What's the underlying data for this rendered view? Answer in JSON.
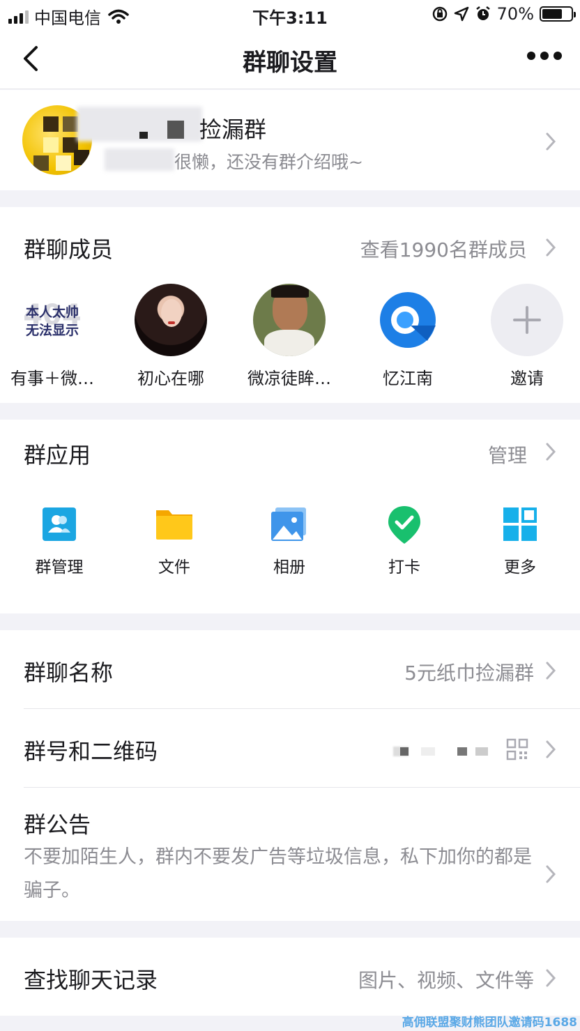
{
  "status_bar": {
    "carrier": "中国电信",
    "time": "下午3:11",
    "battery_percent": "70%",
    "battery_level": 0.7
  },
  "nav": {
    "title": "群聊设置"
  },
  "group": {
    "name": "捡漏群",
    "intro": "很懒，还没有群介绍哦~"
  },
  "members": {
    "title": "群聊成员",
    "view_all": "查看1990名群成员",
    "list": [
      {
        "name": "有事＋微…",
        "avatar_text": "本人太帅\n无法显示",
        "avatar_bg": "404"
      },
      {
        "name": "初心在哪"
      },
      {
        "name": "微凉徒眸…"
      },
      {
        "name": "忆江南"
      },
      {
        "name": "邀请"
      }
    ]
  },
  "apps": {
    "title": "群应用",
    "manage": "管理",
    "items": [
      {
        "label": "群管理",
        "icon": "group-manage-icon"
      },
      {
        "label": "文件",
        "icon": "folder-icon"
      },
      {
        "label": "相册",
        "icon": "photo-album-icon"
      },
      {
        "label": "打卡",
        "icon": "check-in-icon"
      },
      {
        "label": "更多",
        "icon": "grid-more-icon"
      }
    ]
  },
  "settings": {
    "group_name_label": "群聊名称",
    "group_name_value": "5元纸巾捡漏群",
    "group_number_label": "群号和二维码",
    "notice_label": "群公告",
    "notice_text": "不要加陌生人，群内不要发广告等垃圾信息，私下加你的都是骗子。",
    "search_label": "查找聊天记录",
    "search_value": "图片、视频、文件等"
  },
  "watermark": "高佣联盟聚财熊团队邀请码1688",
  "colors": {
    "accent": "#12b7f5",
    "secondary_text": "#8c8c92",
    "background": "#f2f2f7"
  }
}
